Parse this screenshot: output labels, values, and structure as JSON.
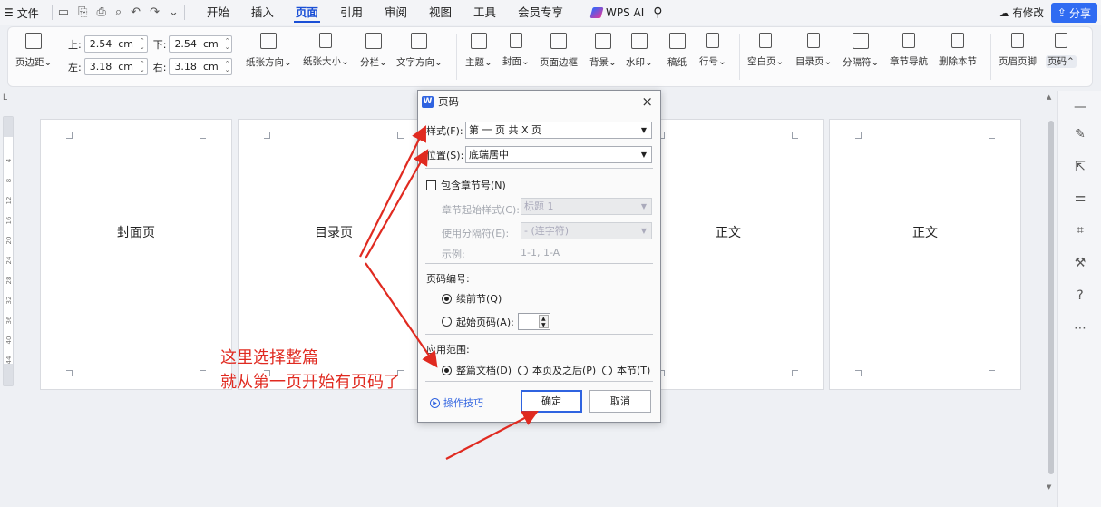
{
  "menubar": {
    "file_label": "文件",
    "menus": [
      "开始",
      "插入",
      "页面",
      "引用",
      "审阅",
      "视图",
      "工具",
      "会员专享"
    ],
    "active_menu": "页面",
    "wps_ai": "WPS AI",
    "modified": "有修改",
    "share": "分享"
  },
  "ribbon": {
    "margins_label": "页边距",
    "top_label": "上:",
    "top_value": "2.54",
    "bottom_label": "下:",
    "bottom_value": "2.54",
    "left_label": "左:",
    "left_value": "3.18",
    "right_label": "右:",
    "right_value": "3.18",
    "unit": "cm",
    "buttons": {
      "orientation": "纸张方向",
      "size": "纸张大小",
      "columns": "分栏",
      "text_direction": "文字方向",
      "theme": "主题",
      "cover": "封面",
      "page_border": "页面边框",
      "background": "背景",
      "watermark": "水印",
      "manuscript": "稿纸",
      "line_number": "行号",
      "blank_page": "空白页",
      "toc_page": "目录页",
      "separator": "分隔符",
      "section_nav": "章节导航",
      "delete_section": "删除本节",
      "header_footer": "页眉页脚",
      "page_number": "页码"
    }
  },
  "ruler": {
    "corner": "L",
    "marks": [
      "4",
      "8",
      "12",
      "16",
      "20",
      "24",
      "28",
      "32",
      "36",
      "40",
      "44"
    ]
  },
  "pages": [
    {
      "title": "封面页"
    },
    {
      "title": "目录页"
    },
    {
      "title": ""
    },
    {
      "title": "正文"
    },
    {
      "title": "正文"
    }
  ],
  "annotation": {
    "line1": "这里选择整篇",
    "line2": "就从第一页开始有页码了"
  },
  "dialog": {
    "title": "页码",
    "close": "×",
    "style_label": "样式(F):",
    "style_value": "第 一 页 共 X 页",
    "position_label": "位置(S):",
    "position_value": "底端居中",
    "include_chapter": "包含章节号(N)",
    "chapter_style_label": "章节起始样式(C):",
    "chapter_style_value": "标题 1",
    "separator_label": "使用分隔符(E):",
    "separator_value": "-   (连字符)",
    "example_label": "示例:",
    "example_value": "1-1, 1-A",
    "numbering_label": "页码编号:",
    "continue_label": "续前节(Q)",
    "start_label": "起始页码(A):",
    "scope_label": "应用范围:",
    "scope_whole": "整篇文档(D)",
    "scope_after": "本页及之后(P)",
    "scope_section": "本节(T)",
    "tips": "操作技巧",
    "ok": "确定",
    "cancel": "取消"
  },
  "colors": {
    "accent": "#2f63e0",
    "annotation": "#e02a20"
  }
}
